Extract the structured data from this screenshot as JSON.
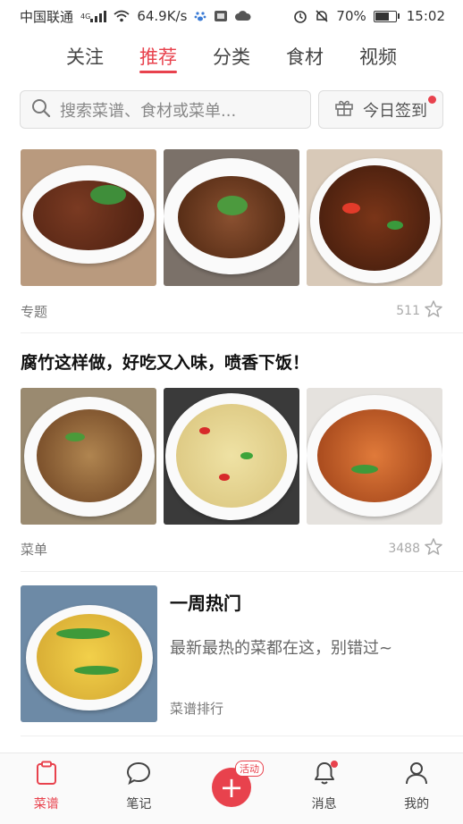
{
  "status_bar": {
    "carrier": "中国联通",
    "network": "4G",
    "speed": "64.9K/s",
    "battery": "70%",
    "battery_level": 0.7,
    "time": "15:02"
  },
  "tabs": [
    {
      "label": "关注",
      "active": false
    },
    {
      "label": "推荐",
      "active": true
    },
    {
      "label": "分类",
      "active": false
    },
    {
      "label": "食材",
      "active": false
    },
    {
      "label": "视频",
      "active": false
    }
  ],
  "search": {
    "placeholder": "搜索菜谱、食材或菜单..."
  },
  "signin": {
    "label": "今日签到"
  },
  "topic_section": {
    "tag": "专题",
    "count": "511"
  },
  "menu_section": {
    "title": "腐竹这样做，好吃又入味，喷香下饭！",
    "tag": "菜单",
    "count": "3488"
  },
  "hot_card": {
    "title": "一周热门",
    "description": "最新最热的菜都在这，别错过~",
    "subtitle": "菜谱排行"
  },
  "bottom_nav": {
    "items": [
      {
        "label": "菜谱",
        "icon": "recipe-icon",
        "active": true
      },
      {
        "label": "笔记",
        "icon": "notes-icon",
        "active": false
      },
      {
        "label": "",
        "icon": "plus-icon",
        "active": false
      },
      {
        "label": "消息",
        "icon": "bell-icon",
        "active": false
      },
      {
        "label": "我的",
        "icon": "user-icon",
        "active": false
      }
    ],
    "activity_badge": "活动"
  },
  "colors": {
    "accent": "#e8424d"
  }
}
